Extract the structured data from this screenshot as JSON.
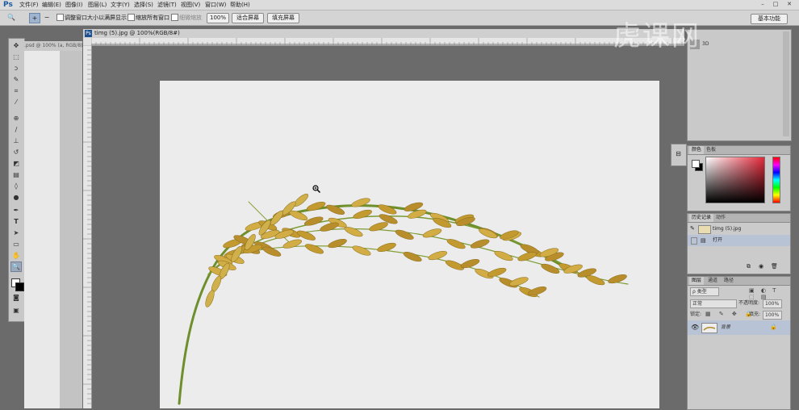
{
  "app": {
    "logo": "Ps"
  },
  "menu": [
    "文件(F)",
    "编辑(E)",
    "图像(I)",
    "图层(L)",
    "文字(Y)",
    "选择(S)",
    "滤镜(T)",
    "视图(V)",
    "窗口(W)",
    "帮助(H)"
  ],
  "window_controls": {
    "min": "–",
    "max": "□",
    "close": "✕"
  },
  "options_bar": {
    "resize_windows_label": "调整窗口大小以满屏显示",
    "zoom_all_label": "缩放所有窗口",
    "scrubby_label": "细微缩放",
    "zoom_100": "100%",
    "fit_screen": "适合屏幕",
    "fill_screen": "填充屏幕"
  },
  "document": {
    "tab_title": "timg (5).jpg @ 100%(RGB/8#)",
    "second_tab_title": "   .psd @ 100% (a, RGB/8)"
  },
  "workspace": {
    "label": "基本功能"
  },
  "panels": {
    "top_panel": {
      "item": "3D"
    },
    "color": {
      "tabs": [
        "颜色",
        "色板"
      ]
    },
    "history": {
      "tabs": [
        "历史记录",
        "动作"
      ],
      "snapshot": "timg (5).jpg",
      "items": [
        "打开"
      ]
    },
    "layers": {
      "tabs": [
        "图层",
        "通道",
        "路径"
      ],
      "kind_filter": "ρ 类型",
      "blend_mode": "正常",
      "opacity_label": "不透明度:",
      "opacity_value": "100%",
      "lock_label": "锁定:",
      "fill_label": "填充:",
      "fill_value": "100%",
      "layer_name": "背景"
    }
  },
  "watermark": "虎课网",
  "colors": {
    "accent": "#1b5aa0",
    "selection": "#b9c3d6",
    "canvas": "#ececec"
  }
}
